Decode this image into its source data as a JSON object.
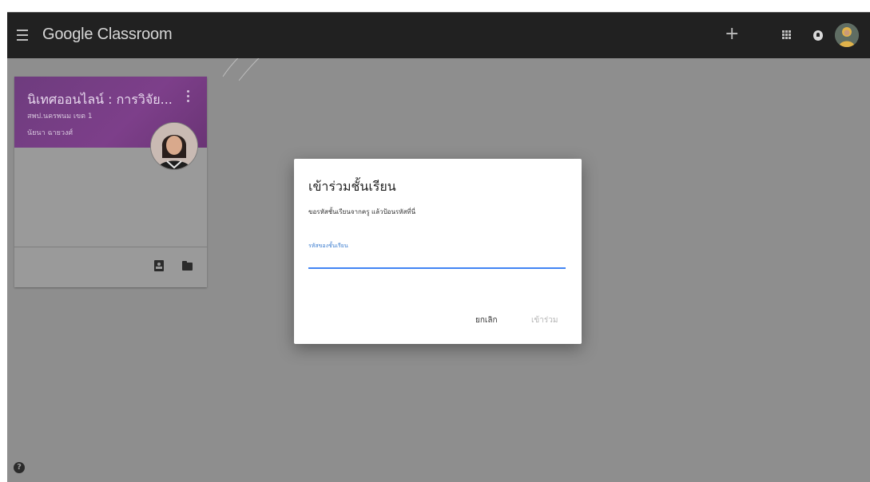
{
  "header": {
    "app_title": "Google Classroom",
    "menu_icon": "hamburger-menu-icon",
    "plus_icon": "+",
    "apps_icon": "apps-grid-icon",
    "notification_icon": "notification-icon",
    "account_icon": "account-avatar"
  },
  "card": {
    "title": "นิเทศออนไลน์ : การวิจัย...",
    "section": "สพป.นครพนม เขต 1",
    "teacher": "นัยนา ฉายวงศ์",
    "more_icon": "more-vert-icon",
    "assignments_icon": "assignment-icon",
    "folder_icon": "folder-icon"
  },
  "dialog": {
    "title": "เข้าร่วมชั้นเรียน",
    "description": "ขอรหัสชั้นเรียนจากครู แล้วป้อนรหัสที่นี่",
    "field_label": "รหัสของชั้นเรียน",
    "field_value": "",
    "cancel_label": "ยกเลิก",
    "join_label": "เข้าร่วม"
  },
  "help": {
    "label": "?"
  },
  "colors": {
    "topbar": "#212121",
    "backdrop": "#8e8e8e",
    "card_header": "#7d3f8a",
    "accent_blue": "#4285f4"
  }
}
